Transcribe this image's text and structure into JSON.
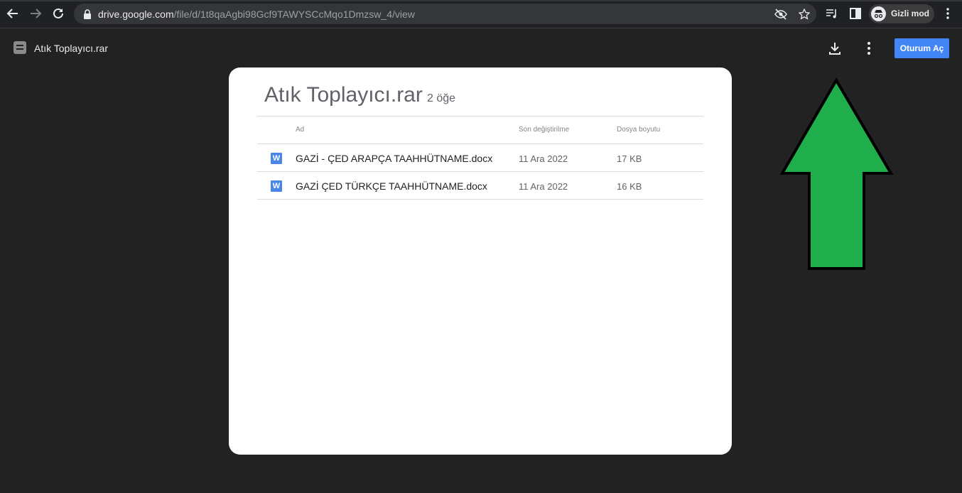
{
  "browser": {
    "url_host": "drive.google.com",
    "url_path": "/file/d/1t8qaAgbi98Gcf9TAWYSCcMqo1Dmzsw_4/view",
    "profile_label": "Gizli mod"
  },
  "viewer": {
    "file_title": "Atık Toplayıcı.rar",
    "signin_label": "Oturum Aç"
  },
  "archive": {
    "title": "Atık Toplayıcı.rar",
    "item_count": "2 öğe",
    "columns": {
      "name": "Ad",
      "modified": "Son değiştirilme",
      "size": "Dosya boyutu"
    },
    "files": [
      {
        "icon": "W",
        "name": "GAZİ - ÇED ARAPÇA TAAHHÜTNAME.docx",
        "modified": "11 Ara 2022",
        "size": "17 KB"
      },
      {
        "icon": "W",
        "name": "GAZİ ÇED TÜRKÇE TAAHHÜTNAME.docx",
        "modified": "11 Ara 2022",
        "size": "16 KB"
      }
    ]
  },
  "colors": {
    "page_bg": "#222222",
    "accent_blue": "#4285f4",
    "arrow_green": "#1fae4b"
  }
}
